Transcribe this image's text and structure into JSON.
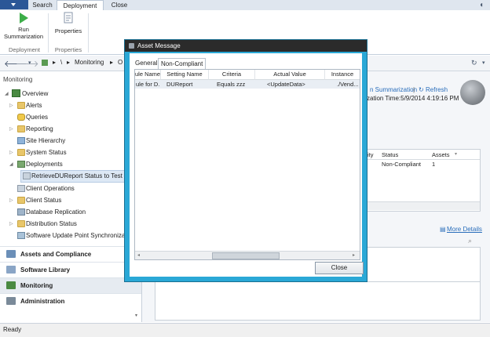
{
  "ribbon": {
    "tabs": [
      "Search",
      "Deployment",
      "Close"
    ],
    "run_summarization": "Run Summarization",
    "properties": "Properties",
    "group_deployment": "Deployment",
    "group_properties": "Properties"
  },
  "address": {
    "crumbs": [
      "\\",
      "Monitoring",
      "O"
    ]
  },
  "leftnav": {
    "header": "Monitoring",
    "items": [
      {
        "label": "Overview",
        "indent": 0
      },
      {
        "label": "Alerts",
        "indent": 1
      },
      {
        "label": "Queries",
        "indent": 1
      },
      {
        "label": "Reporting",
        "indent": 1
      },
      {
        "label": "Site Hierarchy",
        "indent": 1
      },
      {
        "label": "System Status",
        "indent": 1
      },
      {
        "label": "Deployments",
        "indent": 1
      },
      {
        "label": "RetrieveDUReport Status to Test Dev",
        "indent": 2
      },
      {
        "label": "Client Operations",
        "indent": 1
      },
      {
        "label": "Client Status",
        "indent": 1
      },
      {
        "label": "Database Replication",
        "indent": 1
      },
      {
        "label": "Distribution Status",
        "indent": 1
      },
      {
        "label": "Software Update Point Synchronization",
        "indent": 1
      }
    ],
    "workspaces": [
      "Assets and Compliance",
      "Software Library",
      "Monitoring",
      "Administration"
    ]
  },
  "right": {
    "summarization_link": "n Summarization",
    "refresh_link": "Refresh",
    "summarization_time": "zation Time:5/9/2014 4:19:16 PM",
    "columns": [
      "ity",
      "Status",
      "Assets"
    ],
    "row": [
      "",
      "Non-Compliant",
      "1"
    ],
    "more_details": "More Details"
  },
  "dialog": {
    "title": "Asset Message",
    "tabs": [
      "General",
      "Non-Compliant"
    ],
    "columns": [
      "ule Name",
      "Setting Name",
      "Criteria",
      "Actual Value",
      "Instance"
    ],
    "rows": [
      [
        "ule for D...",
        "DUReport",
        "Equals zzz",
        "<UpdateData>",
        "./Vend..."
      ]
    ],
    "close_label": "Close"
  },
  "status": {
    "text": "Ready"
  }
}
